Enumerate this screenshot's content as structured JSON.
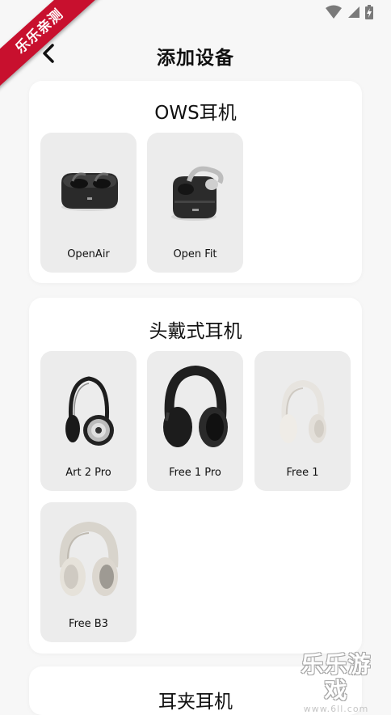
{
  "status_bar": {
    "icons": [
      "wifi-icon",
      "cell-signal-icon",
      "battery-icon"
    ]
  },
  "ribbon": {
    "text": "乐乐亲测"
  },
  "header": {
    "title": "添加设备",
    "back_icon": "chevron-left-icon"
  },
  "sections": [
    {
      "title": "OWS耳机",
      "items": [
        {
          "label": "OpenAir",
          "image": "open-ear-earbuds-case"
        },
        {
          "label": "Open Fit",
          "image": "open-ear-earbuds-case"
        }
      ]
    },
    {
      "title": "头戴式耳机",
      "items": [
        {
          "label": "Art 2 Pro",
          "image": "headphones-black-silver"
        },
        {
          "label": "Free 1 Pro",
          "image": "headphones-black"
        },
        {
          "label": "Free 1",
          "image": "headphones-white"
        },
        {
          "label": "Free B3",
          "image": "headphones-beige"
        }
      ]
    },
    {
      "title": "耳夹耳机",
      "items": []
    }
  ],
  "watermark": {
    "main": "乐乐游戏",
    "sub": "www.6ll.com"
  },
  "colors": {
    "ribbon": "#c8102e",
    "card": "#ffffff",
    "tile": "#ececec",
    "background": "#f7f7f7"
  }
}
